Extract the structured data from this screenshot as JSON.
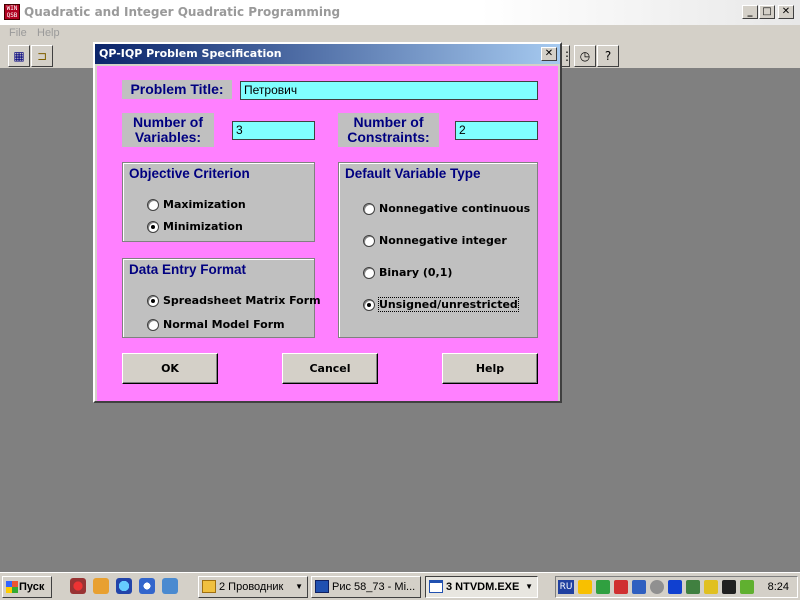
{
  "window": {
    "title": "Quadratic and Integer Quadratic Programming",
    "icon_text": "WIN QSB",
    "minimize": "_",
    "maximize": "□",
    "close": "✕"
  },
  "menu": {
    "file": "File",
    "help": "Help"
  },
  "dialog": {
    "title": "QP-IQP Problem Specification",
    "close": "✕",
    "problem_title_label": "Problem Title:",
    "problem_title_value": "Петрович",
    "num_variables_label": "Number of Variables:",
    "num_variables_value": "3",
    "num_constraints_label": "Number of Constraints:",
    "num_constraints_value": "2",
    "objective": {
      "title": "Objective Criterion",
      "options": [
        "Maximization",
        "Minimization"
      ],
      "selected": "Minimization"
    },
    "data_entry": {
      "title": "Data Entry Format",
      "options": [
        "Spreadsheet Matrix Form",
        "Normal Model Form"
      ],
      "selected": "Spreadsheet Matrix Form"
    },
    "var_type": {
      "title": "Default Variable Type",
      "options": [
        "Nonnegative continuous",
        "Nonnegative integer",
        "Binary (0,1)",
        "Unsigned/unrestricted"
      ],
      "selected": "Unsigned/unrestricted"
    },
    "buttons": {
      "ok": "OK",
      "cancel": "Cancel",
      "help": "Help"
    }
  },
  "taskbar": {
    "start": "Пуск",
    "tasks": [
      "2 Проводник",
      "Рис 58_73 - Mi...",
      "3 NTVDM.EXE"
    ],
    "lang": "RU",
    "clock": "8:24"
  }
}
